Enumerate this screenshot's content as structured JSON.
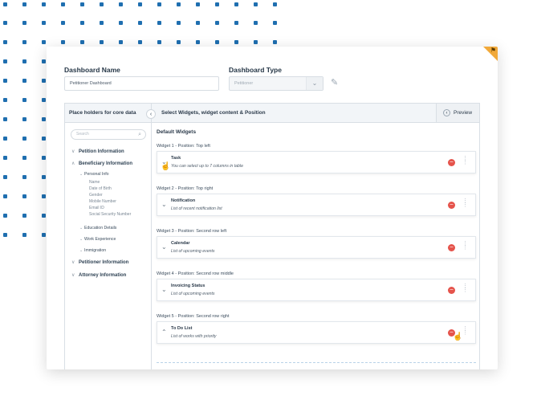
{
  "form": {
    "dashboard_name_label": "Dashboard Name",
    "dashboard_name_value": "Petitioner Dashboard",
    "dashboard_type_label": "Dashboard Type",
    "dashboard_type_value": "Petitioner"
  },
  "left_panel": {
    "title": "Place holders for core data",
    "search_placeholder": "Search",
    "items": {
      "petition_information": "Petition Information",
      "beneficiary_information": "Beneficiary Information",
      "personal_info": "Personal Info",
      "name": "Name",
      "date_of_birth": "Date of Birth",
      "gender": "Gender",
      "mobile_number": "Mobile Number",
      "email_id": "Email ID",
      "social_security_number": "Social Security Number",
      "education_details": "Education Details",
      "work_experience": "Work Experience",
      "immigration": "Immigration",
      "petitioner_information": "Petitioner Information",
      "attorney_information": "Attorney Information"
    }
  },
  "right_panel": {
    "title": "Select Widgets, widget content & Position",
    "preview_label": "Preview",
    "default_widgets_label": "Default Widgets",
    "widgets": [
      {
        "position_label": "Widget 1 - Position: Top left",
        "name": "Task",
        "description": "You can select up to 7 columns in table"
      },
      {
        "position_label": "Widget 2 - Position: Top right",
        "name": "Notification",
        "description": "List of recent notification list"
      },
      {
        "position_label": "Widget 3 - Position: Second row left",
        "name": "Calendar",
        "description": "List of upcoming events"
      },
      {
        "position_label": "Widget 4 - Position: Second row middle",
        "name": "Invoicing Status",
        "description": "List of upcoming events"
      },
      {
        "position_label": "Widget 5 - Position: Second row right",
        "name": "To Do List",
        "description": "List of works with priority"
      }
    ]
  },
  "colors": {
    "accent_dots": "#1f6fb0",
    "remove_red": "#e5534b",
    "corner_badge": "#f1a93a"
  }
}
